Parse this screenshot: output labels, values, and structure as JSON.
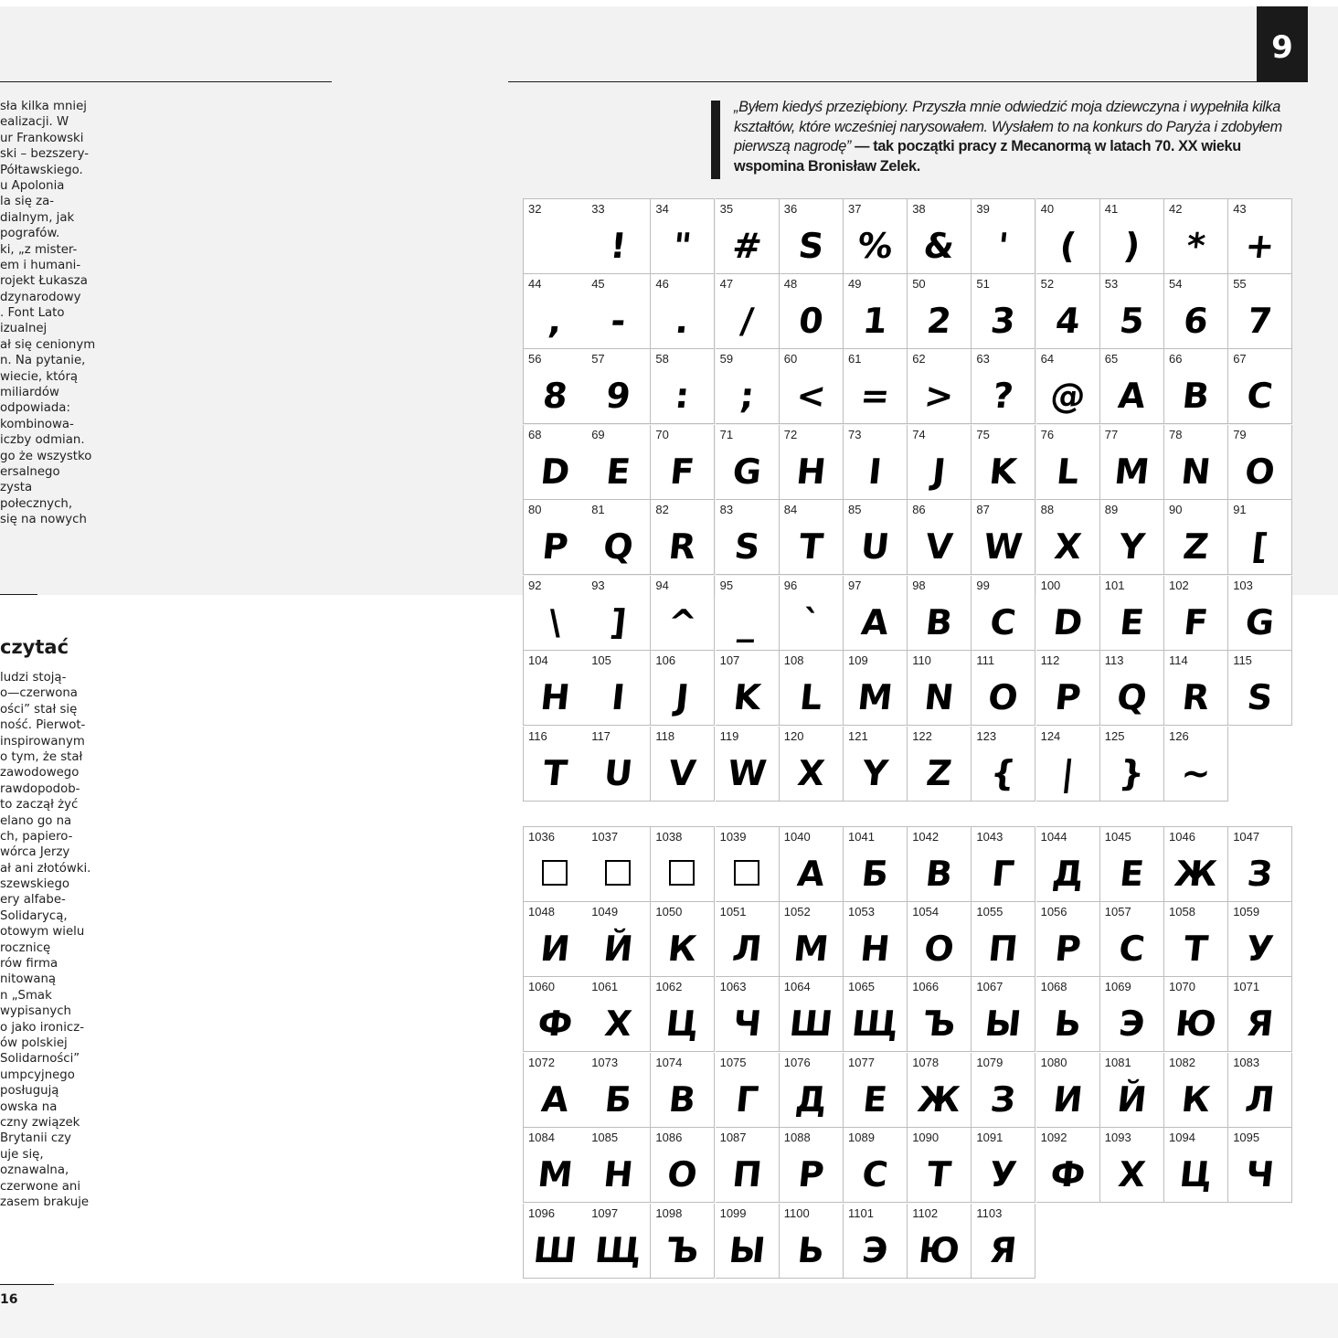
{
  "page": {
    "page_number": "9",
    "footer_page_number": "16",
    "left_heading": "czytać",
    "left_col_top": [
      "sła kilka mniej",
      "ealizacji. W",
      "ur Frankowski",
      "ski – bezszery-",
      "Półtawskiego.",
      "u Apolonia",
      "la się za-",
      "dialnym, jak",
      "pografów.",
      "ki, „z mister-",
      "em i humani-",
      "rojekt Łukasza",
      "dzynarodowy",
      ". Font Lato",
      "izualnej",
      "ał się cenionym",
      "n. Na pytanie,",
      "wiecie, którą",
      "miliardów",
      "odpowiada:",
      "kombinowa-",
      "iczby odmian.",
      "go że wszystko",
      "ersalnego",
      "zysta",
      "połecznych,",
      "się na nowych"
    ],
    "left_col_bottom": [
      "ludzi stoją-",
      "o—czerwona",
      "ości” stał się",
      "ność. Pierwot-",
      "inspirowanym",
      "o tym, że stał",
      "zawodowego",
      "rawdopodob-",
      "to zaczął żyć",
      "elano go na",
      "ch, papiero-",
      "wórca Jerzy",
      "ał ani złotówki.",
      "szewskiego",
      "ery alfabe-",
      "Solidarycą,",
      "otowym wielu",
      "rocznicę",
      "rów firma",
      "nitowaną",
      "n „Smak",
      "wypisanych",
      "o jako ironicz-",
      "ów polskiej",
      "Solidarności”",
      "umpcyjnego",
      "posługują",
      "owska na",
      "czny związek",
      "Brytanii czy",
      "uje się,",
      "oznawalna,",
      "czerwone ani",
      "zasem brakuje"
    ],
    "quote_italic": "„Byłem kiedyś przeziębiony. Przyszła mnie odwiedzić moja dziewczyna i wypełniła kilka kształtów, które wcześniej narysowałem. Wysłałem to na konkurs do Paryża i zdobyłem pierwszą nagrodę”",
    "quote_bold": " — tak początki pracy z Mecanormą w latach 70. XX wieku wspomina Bronisław Zelek."
  },
  "latin_grid": [
    {
      "n": "32",
      "g": ""
    },
    {
      "n": "33",
      "g": "!"
    },
    {
      "n": "34",
      "g": "\""
    },
    {
      "n": "35",
      "g": "#"
    },
    {
      "n": "36",
      "g": "S"
    },
    {
      "n": "37",
      "g": "%"
    },
    {
      "n": "38",
      "g": "&"
    },
    {
      "n": "39",
      "g": "'"
    },
    {
      "n": "40",
      "g": "("
    },
    {
      "n": "41",
      "g": ")"
    },
    {
      "n": "42",
      "g": "*"
    },
    {
      "n": "43",
      "g": "+"
    },
    {
      "n": "44",
      "g": ","
    },
    {
      "n": "45",
      "g": "-"
    },
    {
      "n": "46",
      "g": "."
    },
    {
      "n": "47",
      "g": "/"
    },
    {
      "n": "48",
      "g": "0"
    },
    {
      "n": "49",
      "g": "1"
    },
    {
      "n": "50",
      "g": "2"
    },
    {
      "n": "51",
      "g": "3"
    },
    {
      "n": "52",
      "g": "4"
    },
    {
      "n": "53",
      "g": "5"
    },
    {
      "n": "54",
      "g": "6"
    },
    {
      "n": "55",
      "g": "7"
    },
    {
      "n": "56",
      "g": "8"
    },
    {
      "n": "57",
      "g": "9"
    },
    {
      "n": "58",
      "g": ":"
    },
    {
      "n": "59",
      "g": ";"
    },
    {
      "n": "60",
      "g": "<"
    },
    {
      "n": "61",
      "g": "="
    },
    {
      "n": "62",
      "g": ">"
    },
    {
      "n": "63",
      "g": "?"
    },
    {
      "n": "64",
      "g": "@"
    },
    {
      "n": "65",
      "g": "A"
    },
    {
      "n": "66",
      "g": "B"
    },
    {
      "n": "67",
      "g": "C"
    },
    {
      "n": "68",
      "g": "D"
    },
    {
      "n": "69",
      "g": "E"
    },
    {
      "n": "70",
      "g": "F"
    },
    {
      "n": "71",
      "g": "G"
    },
    {
      "n": "72",
      "g": "H"
    },
    {
      "n": "73",
      "g": "I"
    },
    {
      "n": "74",
      "g": "J"
    },
    {
      "n": "75",
      "g": "K"
    },
    {
      "n": "76",
      "g": "L"
    },
    {
      "n": "77",
      "g": "M"
    },
    {
      "n": "78",
      "g": "N"
    },
    {
      "n": "79",
      "g": "O"
    },
    {
      "n": "80",
      "g": "P"
    },
    {
      "n": "81",
      "g": "Q"
    },
    {
      "n": "82",
      "g": "R"
    },
    {
      "n": "83",
      "g": "S"
    },
    {
      "n": "84",
      "g": "T"
    },
    {
      "n": "85",
      "g": "U"
    },
    {
      "n": "86",
      "g": "V"
    },
    {
      "n": "87",
      "g": "W"
    },
    {
      "n": "88",
      "g": "X"
    },
    {
      "n": "89",
      "g": "Y"
    },
    {
      "n": "90",
      "g": "Z"
    },
    {
      "n": "91",
      "g": "["
    },
    {
      "n": "92",
      "g": "\\"
    },
    {
      "n": "93",
      "g": "]"
    },
    {
      "n": "94",
      "g": "^"
    },
    {
      "n": "95",
      "g": "_"
    },
    {
      "n": "96",
      "g": "`"
    },
    {
      "n": "97",
      "g": "A"
    },
    {
      "n": "98",
      "g": "B"
    },
    {
      "n": "99",
      "g": "C"
    },
    {
      "n": "100",
      "g": "D"
    },
    {
      "n": "101",
      "g": "E"
    },
    {
      "n": "102",
      "g": "F"
    },
    {
      "n": "103",
      "g": "G"
    },
    {
      "n": "104",
      "g": "H"
    },
    {
      "n": "105",
      "g": "I"
    },
    {
      "n": "106",
      "g": "J"
    },
    {
      "n": "107",
      "g": "K"
    },
    {
      "n": "108",
      "g": "L"
    },
    {
      "n": "109",
      "g": "M"
    },
    {
      "n": "110",
      "g": "N"
    },
    {
      "n": "111",
      "g": "O"
    },
    {
      "n": "112",
      "g": "P"
    },
    {
      "n": "113",
      "g": "Q"
    },
    {
      "n": "114",
      "g": "R"
    },
    {
      "n": "115",
      "g": "S"
    },
    {
      "n": "116",
      "g": "T"
    },
    {
      "n": "117",
      "g": "U"
    },
    {
      "n": "118",
      "g": "V"
    },
    {
      "n": "119",
      "g": "W"
    },
    {
      "n": "120",
      "g": "X"
    },
    {
      "n": "121",
      "g": "Y"
    },
    {
      "n": "122",
      "g": "Z"
    },
    {
      "n": "123",
      "g": "{"
    },
    {
      "n": "124",
      "g": "|"
    },
    {
      "n": "125",
      "g": "}"
    },
    {
      "n": "126",
      "g": "~"
    }
  ],
  "cyrillic_grid": [
    {
      "n": "1036",
      "g": "□"
    },
    {
      "n": "1037",
      "g": "□"
    },
    {
      "n": "1038",
      "g": "□"
    },
    {
      "n": "1039",
      "g": "□"
    },
    {
      "n": "1040",
      "g": "А"
    },
    {
      "n": "1041",
      "g": "Б"
    },
    {
      "n": "1042",
      "g": "В"
    },
    {
      "n": "1043",
      "g": "Г"
    },
    {
      "n": "1044",
      "g": "Д"
    },
    {
      "n": "1045",
      "g": "Е"
    },
    {
      "n": "1046",
      "g": "Ж"
    },
    {
      "n": "1047",
      "g": "З"
    },
    {
      "n": "1048",
      "g": "И"
    },
    {
      "n": "1049",
      "g": "Й"
    },
    {
      "n": "1050",
      "g": "К"
    },
    {
      "n": "1051",
      "g": "Л"
    },
    {
      "n": "1052",
      "g": "М"
    },
    {
      "n": "1053",
      "g": "Н"
    },
    {
      "n": "1054",
      "g": "О"
    },
    {
      "n": "1055",
      "g": "П"
    },
    {
      "n": "1056",
      "g": "Р"
    },
    {
      "n": "1057",
      "g": "С"
    },
    {
      "n": "1058",
      "g": "Т"
    },
    {
      "n": "1059",
      "g": "У"
    },
    {
      "n": "1060",
      "g": "Ф"
    },
    {
      "n": "1061",
      "g": "Х"
    },
    {
      "n": "1062",
      "g": "Ц"
    },
    {
      "n": "1063",
      "g": "Ч"
    },
    {
      "n": "1064",
      "g": "Ш"
    },
    {
      "n": "1065",
      "g": "Щ"
    },
    {
      "n": "1066",
      "g": "Ъ"
    },
    {
      "n": "1067",
      "g": "Ы"
    },
    {
      "n": "1068",
      "g": "Ь"
    },
    {
      "n": "1069",
      "g": "Э"
    },
    {
      "n": "1070",
      "g": "Ю"
    },
    {
      "n": "1071",
      "g": "Я"
    },
    {
      "n": "1072",
      "g": "А"
    },
    {
      "n": "1073",
      "g": "Б"
    },
    {
      "n": "1074",
      "g": "В"
    },
    {
      "n": "1075",
      "g": "Г"
    },
    {
      "n": "1076",
      "g": "Д"
    },
    {
      "n": "1077",
      "g": "Е"
    },
    {
      "n": "1078",
      "g": "Ж"
    },
    {
      "n": "1079",
      "g": "З"
    },
    {
      "n": "1080",
      "g": "И"
    },
    {
      "n": "1081",
      "g": "Й"
    },
    {
      "n": "1082",
      "g": "К"
    },
    {
      "n": "1083",
      "g": "Л"
    },
    {
      "n": "1084",
      "g": "М"
    },
    {
      "n": "1085",
      "g": "Н"
    },
    {
      "n": "1086",
      "g": "О"
    },
    {
      "n": "1087",
      "g": "П"
    },
    {
      "n": "1088",
      "g": "Р"
    },
    {
      "n": "1089",
      "g": "С"
    },
    {
      "n": "1090",
      "g": "Т"
    },
    {
      "n": "1091",
      "g": "У"
    },
    {
      "n": "1092",
      "g": "Ф"
    },
    {
      "n": "1093",
      "g": "Х"
    },
    {
      "n": "1094",
      "g": "Ц"
    },
    {
      "n": "1095",
      "g": "Ч"
    },
    {
      "n": "1096",
      "g": "Ш"
    },
    {
      "n": "1097",
      "g": "Щ"
    },
    {
      "n": "1098",
      "g": "Ъ"
    },
    {
      "n": "1099",
      "g": "Ы"
    },
    {
      "n": "1100",
      "g": "Ь"
    },
    {
      "n": "1101",
      "g": "Э"
    },
    {
      "n": "1102",
      "g": "Ю"
    },
    {
      "n": "1103",
      "g": "Я"
    }
  ]
}
